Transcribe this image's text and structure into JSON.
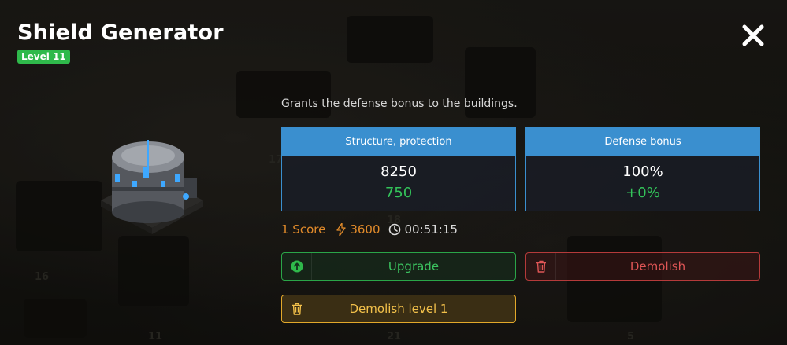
{
  "building": {
    "title": "Shield Generator",
    "level": "Level 11",
    "description": "Grants the defense bonus to the buildings."
  },
  "stats": [
    {
      "header": "Structure, protection",
      "value": "8250",
      "delta": "750"
    },
    {
      "header": "Defense bonus",
      "value": "100%",
      "delta": "+0%"
    }
  ],
  "meta": {
    "score": "1 Score",
    "energy": "3600",
    "time": "00:51:15",
    "energy_icon": "lightning-icon",
    "time_icon": "clock-icon"
  },
  "actions": {
    "upgrade_label": "Upgrade",
    "demolish_label": "Demolish",
    "demolish_level_label": "Demolish level 1"
  },
  "background_numbers": [
    "17",
    "18",
    "16",
    "11",
    "21",
    "5"
  ],
  "colors": {
    "accent_blue": "#3a8fcf",
    "green": "#2fb94b",
    "red": "#b53a3a",
    "gold": "#e2a82a",
    "orange": "#e08a2a"
  }
}
